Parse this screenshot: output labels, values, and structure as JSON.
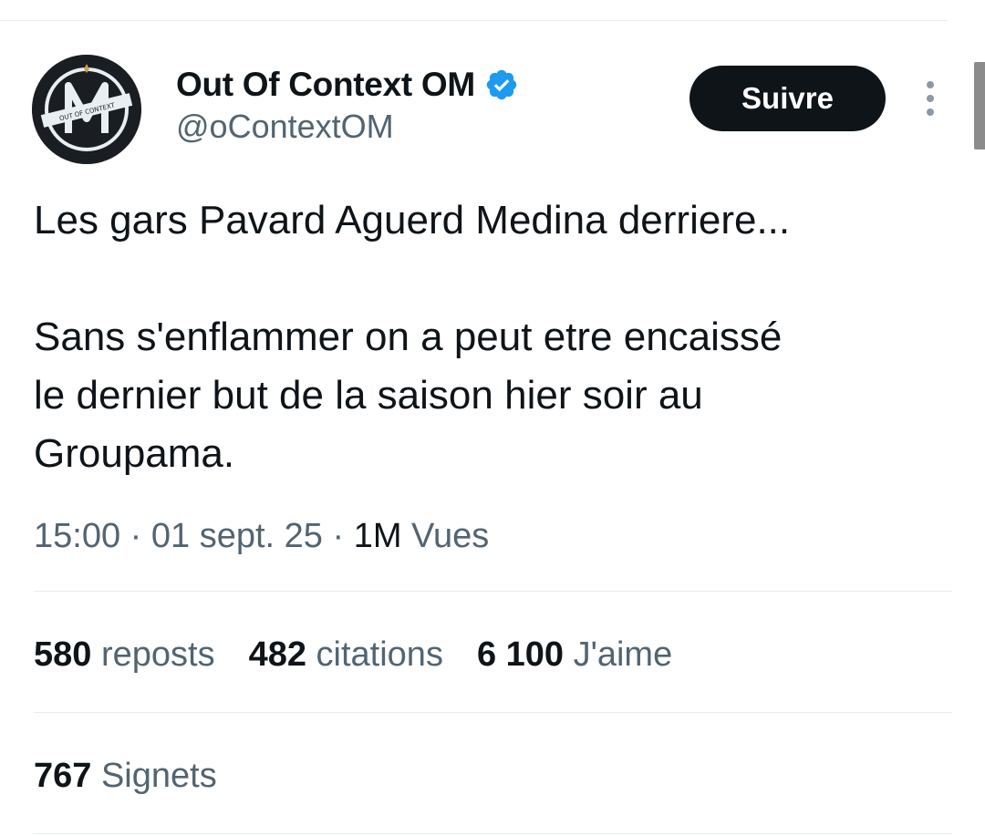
{
  "author": {
    "display_name": "Out Of Context OM",
    "handle": "@oContextOM",
    "verified": true,
    "avatar_logo_text": "OUT OF CONTEXT"
  },
  "follow_button": {
    "label": "Suivre"
  },
  "tweet": {
    "paragraph_1": "Les gars Pavard Aguerd Medina derriere...",
    "paragraph_2": "Sans s'enflammer on a peut etre encaissé\nle dernier but de la saison hier soir au\nGroupama."
  },
  "meta": {
    "time": "15:00",
    "separator": " · ",
    "date": "01 sept. 25",
    "views_count": "1M",
    "views_label": " Vues"
  },
  "stats": {
    "reposts": {
      "count": "580",
      "label": " reposts"
    },
    "quotes": {
      "count": "482",
      "label": " citations"
    },
    "likes": {
      "count": "6 100",
      "label": " J'aime"
    },
    "bookmarks": {
      "count": "767",
      "label": " Signets"
    }
  },
  "icons": {
    "verified": "verified-badge-icon",
    "more": "more-vertical-icon"
  },
  "colors": {
    "text": "#0f1419",
    "secondary": "#536471",
    "verified_blue": "#1d9bf0",
    "button_bg": "#0f1419",
    "divider": "#e6ecf0"
  }
}
